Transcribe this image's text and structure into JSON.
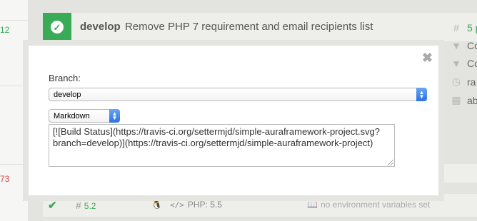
{
  "background": {
    "left_numbers": {
      "top": "12",
      "bottom": "73"
    },
    "build": {
      "branch": "develop",
      "message": "Remove PHP 7 requirement and email recipients list"
    },
    "right_items": [
      {
        "icon": "hash-icon",
        "text": "5 p"
      },
      {
        "icon": "commit-icon",
        "text": "Co"
      },
      {
        "icon": "compare-icon",
        "text": "Co"
      },
      {
        "icon": "clock-icon",
        "text": "ra"
      },
      {
        "icon": "calendar-icon",
        "text": "ab"
      }
    ],
    "job": {
      "number": "5.2",
      "language": "PHP: 5.5",
      "env": "no environment variables set"
    }
  },
  "modal": {
    "branch_label": "Branch:",
    "branch_value": "develop",
    "format_value": "Markdown",
    "badge_text": "[![Build Status](https://travis-ci.org/settermjd/simple-auraframework-project.svg?branch=develop)](https://travis-ci.org/settermjd/simple-auraframework-project)"
  },
  "colors": {
    "passed": "#39aa56",
    "failed": "#db4545",
    "select_accent": "#2b72e3"
  }
}
